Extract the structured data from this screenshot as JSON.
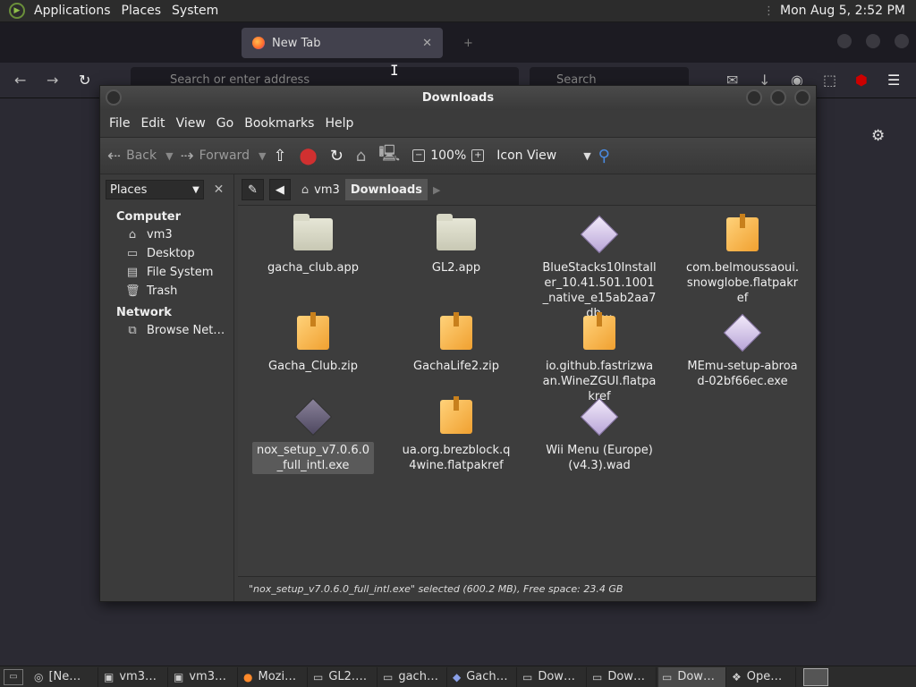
{
  "top_panel": {
    "menus": [
      "Applications",
      "Places",
      "System"
    ],
    "clock": "Mon Aug  5,  2:52 PM"
  },
  "firefox": {
    "active_tab_title": "New Tab",
    "url_placeholder": "Search or enter address",
    "search_placeholder": "Search"
  },
  "window": {
    "title": "Downloads",
    "menus": [
      "File",
      "Edit",
      "View",
      "Go",
      "Bookmarks",
      "Help"
    ]
  },
  "toolbar": {
    "back_label": "Back",
    "forward_label": "Forward",
    "zoom": "100%",
    "view_mode": "Icon View"
  },
  "sidebar": {
    "selector_label": "Places",
    "computer_header": "Computer",
    "computer_items": [
      "vm3",
      "Desktop",
      "File System",
      "Trash"
    ],
    "network_header": "Network",
    "network_items": [
      "Browse Net…"
    ]
  },
  "pathbar": {
    "parent": "vm3",
    "current": "Downloads"
  },
  "files": [
    {
      "name": "gacha_club.app",
      "type": "folder"
    },
    {
      "name": "GL2.app",
      "type": "folder"
    },
    {
      "name": "BlueStacks10Installer_10.41.501.1001_native_e15ab2aa7db…",
      "type": "exe"
    },
    {
      "name": "com.belmoussaoui.snowglobe.flatpakref",
      "type": "package"
    },
    {
      "name": "Gacha_Club.zip",
      "type": "package"
    },
    {
      "name": "GachaLife2.zip",
      "type": "package"
    },
    {
      "name": "io.github.fastrizwaan.WineZGUI.flatpakref",
      "type": "package"
    },
    {
      "name": "MEmu-setup-abroad-02bf66ec.exe",
      "type": "exe"
    },
    {
      "name": "nox_setup_v7.0.6.0_full_intl.exe",
      "type": "exe-selected"
    },
    {
      "name": "ua.org.brezblock.q4wine.flatpakref",
      "type": "package"
    },
    {
      "name": "Wii Menu (Europe) (v4.3).wad",
      "type": "exe"
    }
  ],
  "status": "\"nox_setup_v7.0.6.0_full_intl.exe\" selected (600.2 MB), Free space: 23.4 GB",
  "taskbar": {
    "tasks": [
      "[Ne…",
      "vm3…",
      "vm3…",
      "Mozi…",
      "GL2.…",
      "gach…",
      "Gach…",
      "Dow…",
      "Dow…",
      "Dow…",
      "Ope…"
    ]
  }
}
